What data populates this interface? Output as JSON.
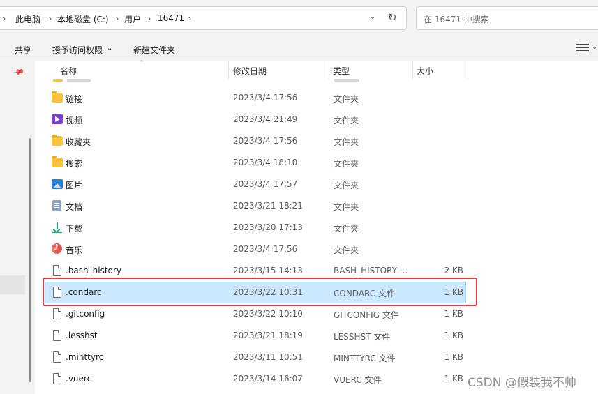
{
  "address_bar": {
    "breadcrumbs": [
      "此电脑",
      "本地磁盘 (C:)",
      "用户",
      "16471"
    ],
    "search_placeholder": "在 16471 中搜索"
  },
  "toolbar": {
    "share_label": "共享",
    "grant_access_label": "授予访问权限",
    "new_folder_label": "新建文件夹"
  },
  "columns": {
    "name": "名称",
    "date_modified": "修改日期",
    "type": "类型",
    "size": "大小"
  },
  "rows": [
    {
      "name": "链接",
      "date": "2023/3/4 17:56",
      "type": "文件夹",
      "size": "",
      "icon": "folder-icon"
    },
    {
      "name": "视频",
      "date": "2023/3/4 21:49",
      "type": "文件夹",
      "size": "",
      "icon": "video-folder-icon"
    },
    {
      "name": "收藏夹",
      "date": "2023/3/4 17:56",
      "type": "文件夹",
      "size": "",
      "icon": "folder-icon"
    },
    {
      "name": "搜索",
      "date": "2023/3/4 18:10",
      "type": "文件夹",
      "size": "",
      "icon": "folder-icon"
    },
    {
      "name": "图片",
      "date": "2023/3/4 17:57",
      "type": "文件夹",
      "size": "",
      "icon": "pictures-folder-icon"
    },
    {
      "name": "文档",
      "date": "2023/3/21 18:21",
      "type": "文件夹",
      "size": "",
      "icon": "documents-folder-icon"
    },
    {
      "name": "下载",
      "date": "2023/3/20 17:13",
      "type": "文件夹",
      "size": "",
      "icon": "downloads-folder-icon"
    },
    {
      "name": "音乐",
      "date": "2023/3/4 17:56",
      "type": "文件夹",
      "size": "",
      "icon": "music-folder-icon"
    },
    {
      "name": ".bash_history",
      "date": "2023/3/15 14:13",
      "type": "BASH_HISTORY ...",
      "size": "2 KB",
      "icon": "file-icon"
    },
    {
      "name": ".condarc",
      "date": "2023/3/22 10:31",
      "type": "CONDARC 文件",
      "size": "1 KB",
      "icon": "file-icon",
      "selected": true
    },
    {
      "name": ".gitconfig",
      "date": "2023/3/22 10:10",
      "type": "GITCONFIG 文件",
      "size": "1 KB",
      "icon": "file-icon"
    },
    {
      "name": ".lesshst",
      "date": "2023/3/21 18:19",
      "type": "LESSHST 文件",
      "size": "1 KB",
      "icon": "file-icon"
    },
    {
      "name": ".minttyrc",
      "date": "2023/3/11 10:51",
      "type": "MINTTYRC 文件",
      "size": "1 KB",
      "icon": "file-icon"
    },
    {
      "name": ".vuerc",
      "date": "2023/3/14 16:07",
      "type": "VUERC 文件",
      "size": "1 KB",
      "icon": "file-icon"
    }
  ],
  "watermark": "CSDN @假装我不帅",
  "colors": {
    "selection_bg": "#cce8ff",
    "selection_border": "#99d1ff",
    "highlight_box": "#e43c3c",
    "folder": "#f8c53a"
  }
}
